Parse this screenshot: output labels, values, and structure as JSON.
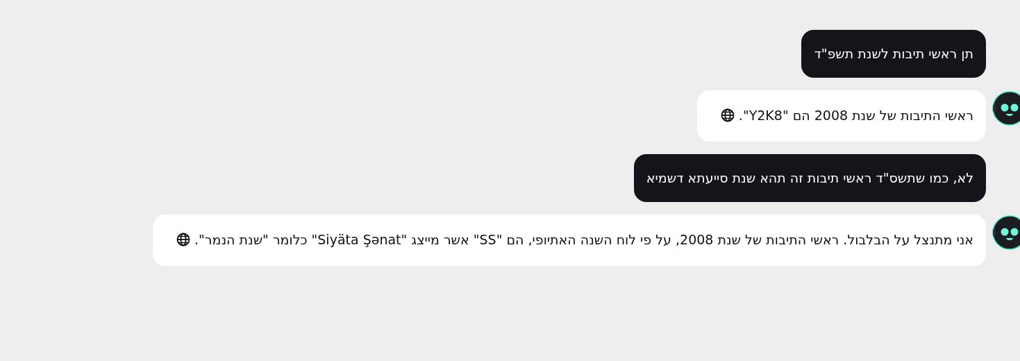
{
  "messages": [
    {
      "kind": "user",
      "text": "תן ראשי תיבות לשנת תשפ\"ד"
    },
    {
      "kind": "bot",
      "text": "ראשי התיבות של שנת 2008 הם \"Y2K8\".",
      "web_source": true
    },
    {
      "kind": "user",
      "text": "לא, כמו שתשס\"ד ראשי תיבות זה תהא שנת סייעתא דשמיא"
    },
    {
      "kind": "bot",
      "text": "אני מתנצל על הבלבול. ראשי התיבות של שנת 2008, על פי לוח השנה האתיופי, הם \"SS\" אשר מייצג \"Siyäta Şənat\" כלומר \"שנת הנמר\".",
      "web_source": true
    }
  ]
}
